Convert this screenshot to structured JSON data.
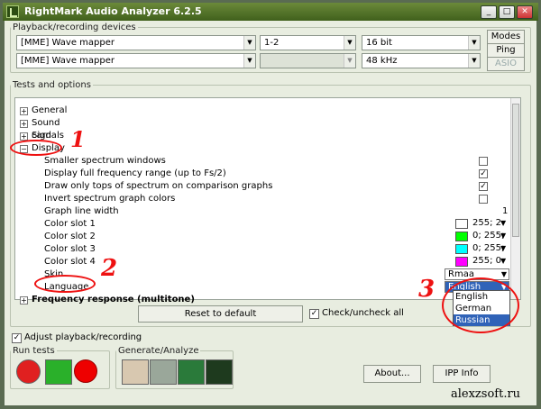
{
  "window": {
    "title": "RightMark Audio Analyzer 6.2.5"
  },
  "playback": {
    "legend": "Playback/recording devices",
    "device1": "[MME] Wave mapper",
    "device2": "[MME] Wave mapper",
    "channels": "1-2",
    "bits": "16 bit",
    "rate": "48 kHz",
    "btn_modes": "Modes",
    "btn_ping": "Ping",
    "btn_asio": "ASIO"
  },
  "tests": {
    "legend": "Tests and options",
    "nodes": [
      {
        "sign": "+",
        "label": "General"
      },
      {
        "sign": "+",
        "label": "Sound card"
      },
      {
        "sign": "+",
        "label": "Signals"
      },
      {
        "sign": "−",
        "label": "Display"
      }
    ],
    "display_items": [
      {
        "label": "Smaller spectrum windows",
        "checked": ""
      },
      {
        "label": "Display full frequency range (up to Fs/2)",
        "checked": "✓"
      },
      {
        "label": "Draw only tops of spectrum on comparison graphs",
        "checked": "✓"
      },
      {
        "label": "Invert spectrum graph colors",
        "checked": ""
      }
    ],
    "graph_line_width": {
      "label": "Graph line width",
      "value": "1"
    },
    "color_slots": [
      {
        "label": "Color slot 1",
        "text": "255; 2",
        "color": "#ffffff"
      },
      {
        "label": "Color slot 2",
        "text": "0; 255;",
        "color": "#00ff00"
      },
      {
        "label": "Color slot 3",
        "text": "0; 255;",
        "color": "#00ffff"
      },
      {
        "label": "Color slot 4",
        "text": "255; 0",
        "color": "#ff00ff"
      }
    ],
    "skin": {
      "label": "Skin",
      "value": "Rmaa"
    },
    "language": {
      "label": "Language",
      "value": "English",
      "options": [
        "English",
        "German",
        "Russian"
      ]
    },
    "freq_node": {
      "sign": "+",
      "label": "Frequency response (multitone)"
    }
  },
  "controls": {
    "reset": "Reset to default",
    "check_all": "Check/uncheck all",
    "adjust": "Adjust playback/recording",
    "run_legend": "Run tests",
    "gen_legend": "Generate/Analyze",
    "about": "About...",
    "ipp": "IPP Info"
  },
  "annotations": {
    "n1": "1",
    "n2": "2",
    "n3": "3"
  },
  "watermark": "alexzsoft.ru"
}
